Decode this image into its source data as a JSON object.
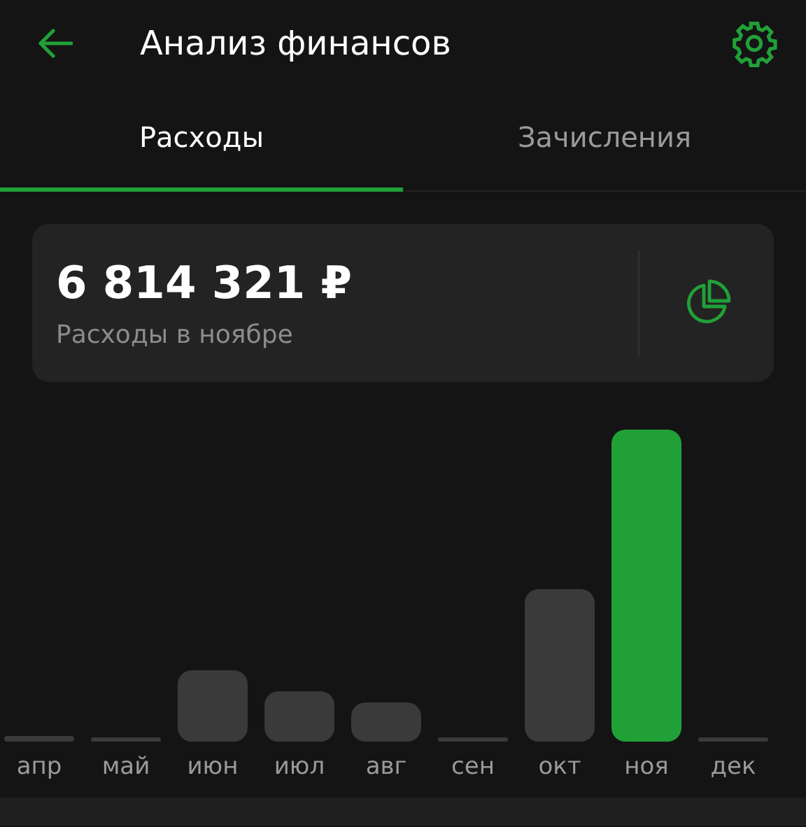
{
  "header": {
    "title": "Анализ финансов"
  },
  "tabs": [
    {
      "label": "Расходы",
      "selected": true
    },
    {
      "label": "Зачисления",
      "selected": false
    }
  ],
  "summary": {
    "amount": "6 814 321 ₽",
    "caption": "Расходы в ноябре"
  },
  "months": [
    {
      "label": "апр",
      "selected": false
    },
    {
      "label": "май",
      "selected": false
    },
    {
      "label": "июн",
      "selected": false
    },
    {
      "label": "июл",
      "selected": false
    },
    {
      "label": "авг",
      "selected": false
    },
    {
      "label": "сен",
      "selected": false
    },
    {
      "label": "окт",
      "selected": false
    },
    {
      "label": "ноя",
      "selected": true
    },
    {
      "label": "дек",
      "selected": false
    }
  ]
}
